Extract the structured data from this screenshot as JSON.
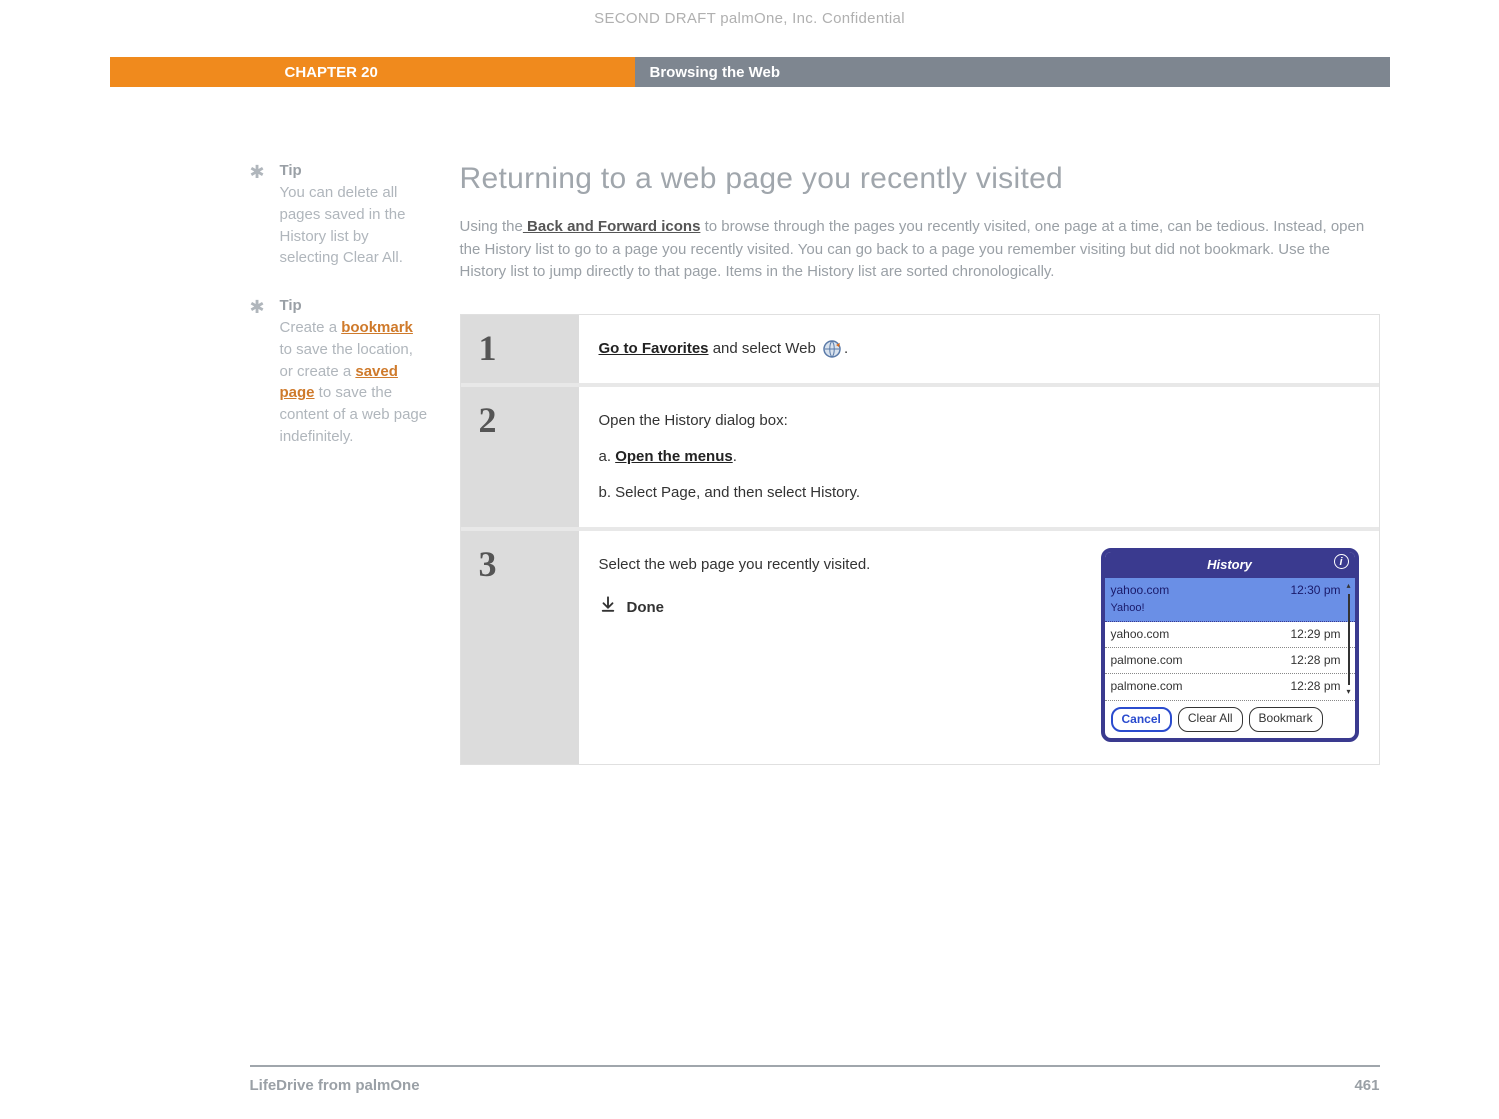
{
  "draft_header": "SECOND DRAFT palmOne, Inc.  Confidential",
  "chapter_label": "CHAPTER 20",
  "chapter_title": "Browsing the Web",
  "tips": [
    {
      "heading": "Tip",
      "body_parts": [
        "You can delete all pages saved in the History list by selecting Clear All."
      ]
    },
    {
      "heading": "Tip",
      "body_parts": [
        "Create a ",
        "bookmark",
        " to save the location, or create a ",
        "saved page",
        " to save the content of a web page indefinitely."
      ]
    }
  ],
  "section_title": "Returning to a web page you recently visited",
  "intro": {
    "pre": "Using the",
    "link": " Back and Forward icons",
    "post": " to browse through the pages you recently visited, one page at a time, can be tedious. Instead, open the History list to go to a page you recently visited. You can go back to a page you remember visiting but did not bookmark. Use the History list to jump directly to that page. Items in the History list are sorted chronologically."
  },
  "steps": {
    "s1": {
      "num": "1",
      "link": "Go to Favorites",
      "post": " and select Web ",
      "tail": "."
    },
    "s2": {
      "num": "2",
      "lead": "Open the History dialog box:",
      "a_label": "a.  ",
      "a_link": "Open the menus",
      "a_tail": ".",
      "b": "b.  Select Page, and then select History."
    },
    "s3": {
      "num": "3",
      "text": "Select the web page you recently visited.",
      "done": "Done"
    }
  },
  "history_dialog": {
    "title": "History",
    "items": [
      {
        "site": "yahoo.com",
        "sub": "Yahoo!",
        "time": "12:30 pm",
        "selected": true
      },
      {
        "site": "yahoo.com",
        "sub": "",
        "time": "12:29 pm",
        "selected": false
      },
      {
        "site": "palmone.com",
        "sub": "",
        "time": "12:28 pm",
        "selected": false
      },
      {
        "site": "palmone.com",
        "sub": "",
        "time": "12:28 pm",
        "selected": false
      }
    ],
    "buttons": {
      "cancel": "Cancel",
      "clear": "Clear All",
      "bookmark": "Bookmark"
    }
  },
  "footer": {
    "product": "LifeDrive from palmOne",
    "page": "461"
  }
}
